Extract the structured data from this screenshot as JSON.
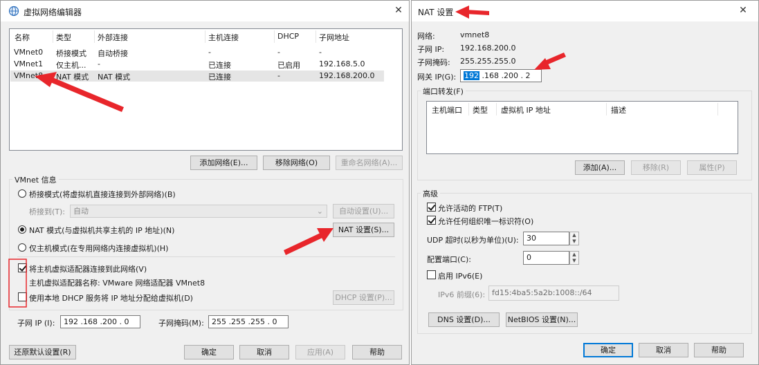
{
  "left_window": {
    "title": "虚拟网络编辑器",
    "columns": [
      "名称",
      "类型",
      "外部连接",
      "主机连接",
      "DHCP",
      "子网地址"
    ],
    "rows": [
      {
        "name": "VMnet0",
        "type": "桥接模式",
        "external": "自动桥接",
        "host": "-",
        "dhcp": "-",
        "subnet": "-"
      },
      {
        "name": "VMnet1",
        "type": "仅主机...",
        "external": "-",
        "host": "已连接",
        "dhcp": "已启用",
        "subnet": "192.168.5.0"
      },
      {
        "name": "VMnet8",
        "type": "NAT 模式",
        "external": "NAT 模式",
        "host": "已连接",
        "dhcp": "-",
        "subnet": "192.168.200.0"
      }
    ],
    "add_network": "添加网络(E)...",
    "remove_network": "移除网络(O)",
    "rename_network": "重命名网络(A)...",
    "vmnet_info_title": "VMnet 信息",
    "bridge_mode": "桥接模式(将虚拟机直接连接到外部网络)(B)",
    "bridge_to_label": "桥接到(T):",
    "bridge_to_value": "自动",
    "auto_settings": "自动设置(U)...",
    "nat_mode": "NAT 模式(与虚拟机共享主机的 IP 地址)(N)",
    "nat_settings": "NAT 设置(S)...",
    "host_only": "仅主机模式(在专用网络内连接虚拟机)(H)",
    "connect_adapter": "将主机虚拟适配器连接到此网络(V)",
    "adapter_name": "主机虚拟适配器名称: VMware 网络适配器 VMnet8",
    "use_dhcp": "使用本地 DHCP 服务将 IP 地址分配给虚拟机(D)",
    "dhcp_settings": "DHCP 设置(P)...",
    "subnet_ip_label": "子网 IP (I):",
    "subnet_ip_value": "192 .168 .200 . 0",
    "subnet_mask_label": "子网掩码(M):",
    "subnet_mask_value": "255 .255 .255 . 0",
    "restore_defaults": "还原默认设置(R)",
    "ok": "确定",
    "cancel": "取消",
    "apply": "应用(A)",
    "help": "帮助"
  },
  "right_window": {
    "title": "NAT 设置",
    "network_label": "网络:",
    "network_value": "vmnet8",
    "subnet_ip_label": "子网 IP:",
    "subnet_ip_value": "192.168.200.0",
    "subnet_mask_label": "子网掩码:",
    "subnet_mask_value": "255.255.255.0",
    "gateway_label": "网关 IP(G):",
    "gateway_part1": "192",
    "gateway_rest": " .168 .200 . 2",
    "port_forward_title": "端口转发(F)",
    "pf_columns": [
      "主机端口",
      "类型",
      "虚拟机 IP 地址",
      "描述"
    ],
    "pf_add": "添加(A)...",
    "pf_remove": "移除(R)",
    "pf_props": "属性(P)",
    "advanced_title": "高级",
    "allow_ftp": "允许活动的 FTP(T)",
    "allow_uid": "允许任何组织唯一标识符(O)",
    "udp_timeout_label": "UDP 超时(以秒为单位)(U):",
    "udp_timeout_value": "30",
    "config_port_label": "配置端口(C):",
    "config_port_value": "0",
    "enable_ipv6": "启用 IPv6(E)",
    "ipv6_prefix_label": "IPv6 前缀(6):",
    "ipv6_prefix_value": "fd15:4ba5:5a2b:1008::/64",
    "dns_settings": "DNS 设置(D)...",
    "netbios_settings": "NetBIOS 设置(N)...",
    "ok": "确定",
    "cancel": "取消",
    "help": "帮助"
  },
  "colors": {
    "annotation_red": "#e8262b",
    "accent_blue": "#0078d7"
  }
}
